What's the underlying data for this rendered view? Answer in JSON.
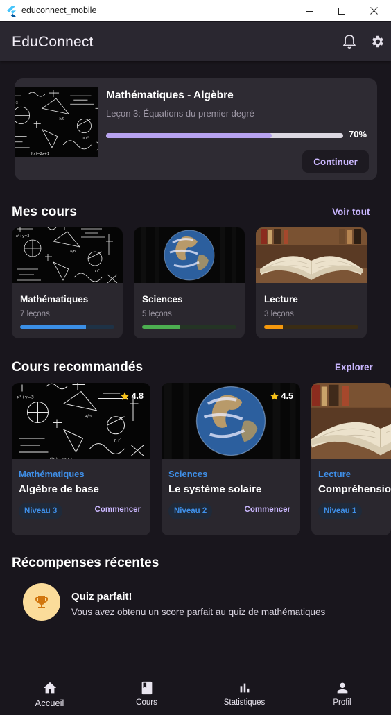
{
  "window": {
    "title": "educonnect_mobile"
  },
  "appbar": {
    "title": "EduConnect",
    "icons": [
      "bell-icon",
      "gear-icon"
    ]
  },
  "continue": {
    "title": "Mathématiques - Algèbre",
    "subtitle": "Leçon 3: Équations du premier degré",
    "progress": 0.7,
    "progress_label": "70%",
    "button": "Continuer"
  },
  "my_courses": {
    "title": "Mes cours",
    "link": "Voir tout",
    "items": [
      {
        "name": "Mathématiques",
        "count": "7 leçons",
        "progress": 0.7,
        "color": "#3b8fe6",
        "track": "#1e3246"
      },
      {
        "name": "Sciences",
        "count": "5 leçons",
        "progress": 0.4,
        "color": "#4cae50",
        "track": "#243424"
      },
      {
        "name": "Lecture",
        "count": "3 leçons",
        "progress": 0.2,
        "color": "#f5980d",
        "track": "#3a2c14"
      }
    ]
  },
  "recommended": {
    "title": "Cours recommandés",
    "link": "Explorer",
    "items": [
      {
        "rating": "4.8",
        "category": "Mathématiques",
        "title": "Algèbre de base",
        "level": "Niveau 3",
        "action": "Commencer"
      },
      {
        "rating": "4.5",
        "category": "Sciences",
        "title": "Le système solaire",
        "level": "Niveau 2",
        "action": "Commencer"
      },
      {
        "rating": "",
        "category": "Lecture",
        "title": "Compréhension",
        "level": "Niveau 1",
        "action": ""
      }
    ]
  },
  "rewards": {
    "title": "Récompenses récentes",
    "items": [
      {
        "title": "Quiz parfait!",
        "description": "Vous avez obtenu un score parfait au quiz de mathématiques",
        "icon": "trophy-icon"
      }
    ]
  },
  "bottom_nav": [
    {
      "label": "Accueil",
      "icon": "home-icon",
      "active": true
    },
    {
      "label": "Cours",
      "icon": "book-icon",
      "active": false
    },
    {
      "label": "Statistiques",
      "icon": "bar-chart-icon",
      "active": false
    },
    {
      "label": "Profil",
      "icon": "person-icon",
      "active": false
    }
  ],
  "colors": {
    "accent": "#b7a2f0",
    "link": "#c9b6ff",
    "category_blue": "#3f8fe8",
    "trophy_bg": "#fbdc9a"
  }
}
